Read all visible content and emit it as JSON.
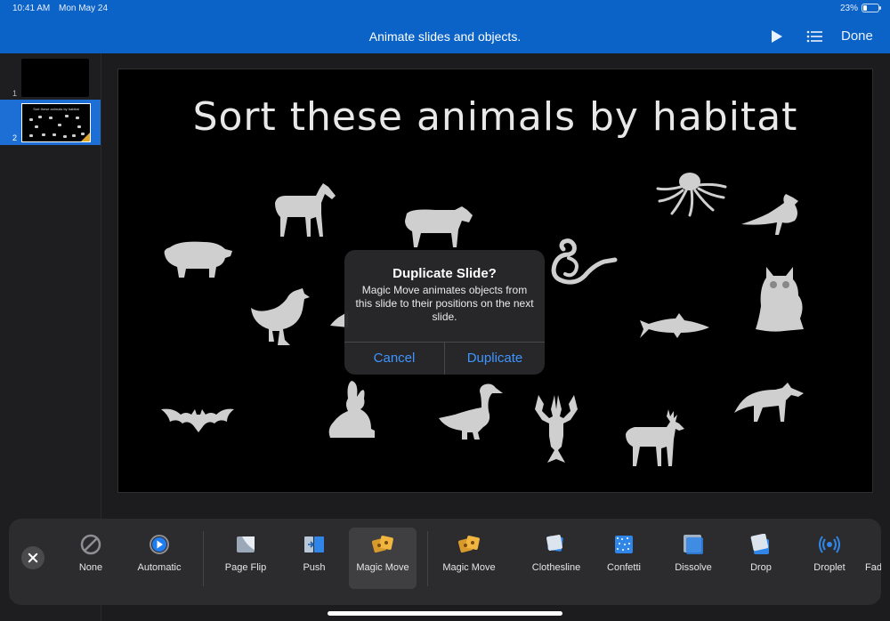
{
  "status_bar": {
    "time": "10:41 AM",
    "date": "Mon May 24",
    "battery": "23%",
    "battery_level": 0.23
  },
  "header": {
    "title": "Animate slides and objects.",
    "done_label": "Done",
    "play_icon": "play-icon",
    "list_icon": "list-icon"
  },
  "sidebar": {
    "slides": [
      {
        "number": "1"
      },
      {
        "number": "2",
        "title": "Sort these animals by habitat"
      }
    ]
  },
  "slide": {
    "title": "Sort these animals by habitat",
    "animals": [
      "pig",
      "horse",
      "cow",
      "chicken",
      "bat",
      "rabbit",
      "goose",
      "lobster",
      "deer",
      "snake",
      "octopus",
      "bird",
      "owl",
      "shark",
      "wolf"
    ]
  },
  "dialog": {
    "title": "Duplicate Slide?",
    "message": "Magic Move animates objects from this slide to their positions on the next slide.",
    "cancel_label": "Cancel",
    "confirm_label": "Duplicate"
  },
  "transitions": [
    {
      "label": "None",
      "icon": "none-icon"
    },
    {
      "label": "Automatic",
      "icon": "automatic-icon"
    },
    {
      "label": "Page Flip",
      "icon": "page-flip-icon"
    },
    {
      "label": "Push",
      "icon": "push-icon"
    },
    {
      "label": "Magic Move",
      "icon": "magic-move-icon",
      "selected": true
    },
    {
      "label": "Magic Move",
      "icon": "magic-move-icon"
    },
    {
      "label": "Clothesline",
      "icon": "clothesline-icon"
    },
    {
      "label": "Confetti",
      "icon": "confetti-icon"
    },
    {
      "label": "Dissolve",
      "icon": "dissolve-icon"
    },
    {
      "label": "Drop",
      "icon": "drop-icon"
    },
    {
      "label": "Droplet",
      "icon": "droplet-icon"
    },
    {
      "label": "Fad",
      "icon": "fade-icon"
    }
  ],
  "colors": {
    "header_blue": "#0b63c8",
    "accent_blue": "#3e95ff",
    "selected_thumb": "#1d6fd6"
  }
}
